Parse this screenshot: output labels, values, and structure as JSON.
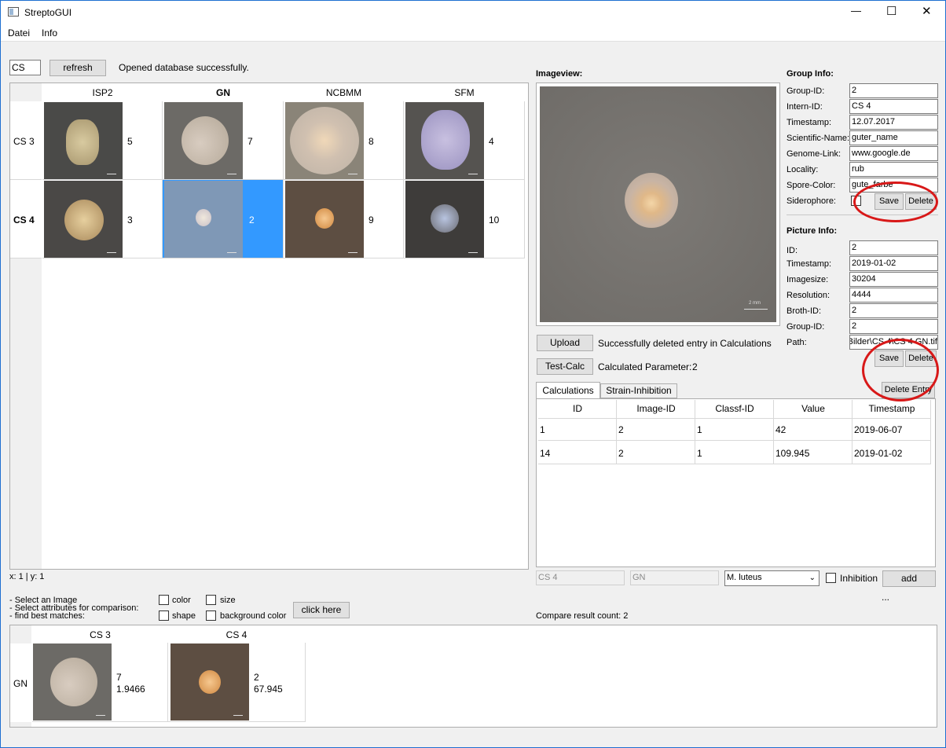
{
  "window": {
    "title": "StreptoGUI",
    "minimize": "—",
    "maximize": "☐",
    "close": "✕"
  },
  "menu": {
    "file": "Datei",
    "info": "Info"
  },
  "toolbar": {
    "search_value": "CS",
    "refresh_label": "refresh",
    "status": "Opened database successfully."
  },
  "grid": {
    "columns": [
      "ISP2",
      "GN",
      "NCBMM",
      "SFM"
    ],
    "rows": [
      {
        "label": "CS 3",
        "counts": [
          "5",
          "7",
          "8",
          "4"
        ]
      },
      {
        "label": "CS 4",
        "counts": [
          "3",
          "2",
          "9",
          "10"
        ]
      }
    ],
    "selected": {
      "row": 1,
      "col": 1
    }
  },
  "coords": "x: 1 | y: 1",
  "imageview": {
    "title": "Imageview:",
    "scale_label": "2 mm"
  },
  "group_info": {
    "title": "Group Info:",
    "fields": [
      {
        "label": "Group-ID:",
        "value": "2"
      },
      {
        "label": "Intern-ID:",
        "value": "CS 4"
      },
      {
        "label": "Timestamp:",
        "value": "12.07.2017"
      },
      {
        "label": "Scientific-Name:",
        "value": "guter_name"
      },
      {
        "label": "Genome-Link:",
        "value": "www.google.de"
      },
      {
        "label": "Locality:",
        "value": "rub"
      },
      {
        "label": "Spore-Color:",
        "value": "gute_farbe"
      }
    ],
    "siderophore_label": "Siderophore:",
    "save_label": "Save",
    "delete_label": "Delete"
  },
  "picture_info": {
    "title": "Picture Info:",
    "fields": [
      {
        "label": "ID:",
        "value": "2"
      },
      {
        "label": "Timestamp:",
        "value": "2019-01-02"
      },
      {
        "label": "Imagesize:",
        "value": "30204"
      },
      {
        "label": "Resolution:",
        "value": "4444"
      },
      {
        "label": "Broth-ID:",
        "value": "2"
      },
      {
        "label": "Group-ID:",
        "value": "2"
      },
      {
        "label": "Path:",
        "value": "Bilder\\CS 4\\CS 4 GN.tif"
      }
    ],
    "save_label": "Save",
    "delete_label": "Delete"
  },
  "actions": {
    "upload_label": "Upload",
    "upload_status": "Successfully deleted entry in Calculations",
    "testcalc_label": "Test-Calc",
    "calc_label": "Calculated Parameter:",
    "calc_value": "2",
    "delete_entry_label": "Delete Entry"
  },
  "tabs": [
    "Calculations",
    "Strain-Inhibition"
  ],
  "calc_table": {
    "headers": [
      "ID",
      "Image-ID",
      "Classf-ID",
      "Value",
      "Timestamp"
    ],
    "rows": [
      [
        "1",
        "2",
        "1",
        "42",
        "2019-06-07"
      ],
      [
        "14",
        "2",
        "1",
        "109.945",
        "2019-01-02"
      ]
    ]
  },
  "inhibition": {
    "field1": "CS 4",
    "field2": "GN",
    "select_value": "M. luteus",
    "checkbox_label": "Inhibition",
    "add_label": "add",
    "ellipsis": "..."
  },
  "compare": {
    "instructions": [
      "- Select an Image",
      "- Select attributes for comparison:",
      "- find best matches:"
    ],
    "options": [
      "color",
      "size",
      "shape",
      "background color"
    ],
    "button_label": "click here",
    "result_count": "Compare result count: 2"
  },
  "results": {
    "row_label": "GN",
    "columns": [
      "CS 3",
      "CS 4"
    ],
    "items": [
      {
        "line1": "7",
        "line2": "1.9466"
      },
      {
        "line1": "2",
        "line2": "67.945"
      }
    ]
  },
  "colors": {
    "selection": "#3399ff",
    "annotation": "#d81818",
    "titlebar_border": "#1e6fd0"
  }
}
